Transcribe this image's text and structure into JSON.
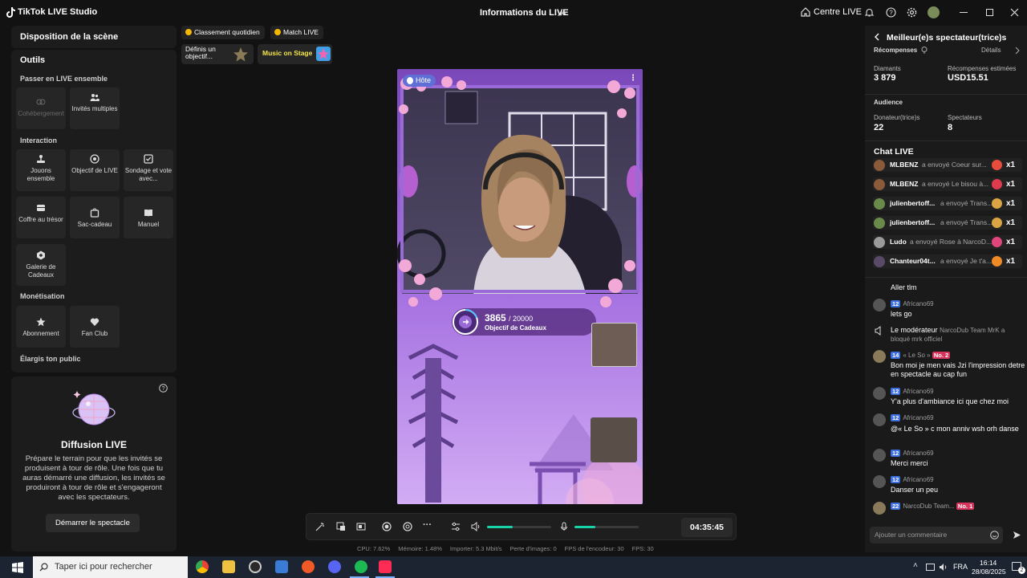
{
  "titlebar": {
    "app_name": "TikTok LIVE Studio",
    "center_title": "Informations du LIVE",
    "home_label": "Centre LIVE"
  },
  "left": {
    "scene_title": "Disposition de la scène",
    "tools_title": "Outils",
    "sections": {
      "together": "Passer en LIVE ensemble",
      "interaction": "Interaction",
      "monetisation": "Monétisation",
      "audience": "Élargis ton public"
    },
    "tools": {
      "cohost": "Cohébergement",
      "multi_guests": "Invités multiples",
      "play_together": "Jouons ensemble",
      "live_goal": "Objectif de LIVE",
      "poll": "Sondage et vote avec...",
      "treasure": "Coffre au trésor",
      "gift_bag": "Sac-cadeau",
      "manual": "Manuel",
      "gift_gallery": "Galerie de Cadeaux",
      "subscription": "Abonnement",
      "fan_club": "Fan Club"
    },
    "diffusion": {
      "title": "Diffusion LIVE",
      "description": "Prépare le terrain pour que les invités se produisent à tour de rôle. Une fois que tu auras démarré une diffusion, les invités se produiront à tour de rôle et s'engageront avec les spectateurs.",
      "button": "Démarrer le spectacle"
    }
  },
  "top_chips": {
    "daily_ranking": "Classement quotidien",
    "match_live": "Match LIVE",
    "goal_card": "Définis un objectif...",
    "music_card": "Music on Stage"
  },
  "stream": {
    "host_label": "Hôte",
    "goal_current": "3865",
    "goal_total": "/ 20000",
    "goal_label": "Objectif de Cadeaux",
    "goal_progress": 0.193
  },
  "controls": {
    "volume_level": 0.4,
    "mic_level": 0.32,
    "timer": "04:35:45"
  },
  "stats": {
    "cpu": "CPU:  7.62%",
    "memory": "Mémoire:  1.48%",
    "import": "Importer:  5.3 Mbit/s",
    "frame_loss": "Perte d'images:  0",
    "encoder_fps": "FPS de l'encodeur:  30",
    "fps": "FPS:  30"
  },
  "right": {
    "header": "Meilleur(e)s spectateur(trice)s",
    "rewards_label": "Récompenses",
    "details": "Détails",
    "diamonds_label": "Diamants",
    "diamonds_value": "3 879",
    "est_rewards_label": "Récompenses estimées",
    "est_rewards_value": "USD15.51",
    "audience_label": "Audience",
    "donors_label": "Donateur(trice)s",
    "donors_value": "22",
    "viewers_label": "Spectateurs",
    "viewers_value": "8",
    "chat_title": "Chat LIVE",
    "gifts": [
      {
        "user": "MLBENZ",
        "msg": "a envoyé Coeur sur...",
        "count": "x1",
        "color": "#e74c3c"
      },
      {
        "user": "MLBENZ",
        "msg": "a envoyé Le bisou à...",
        "count": "x1",
        "color": "#e03a4e"
      },
      {
        "user": "julienbertoff...",
        "msg": "a envoyé Trans...",
        "count": "x1",
        "color": "#d9a441"
      },
      {
        "user": "julienbertoff...",
        "msg": "a envoyé Trans...",
        "count": "x1",
        "color": "#d9a441"
      },
      {
        "user": "Ludo",
        "msg": "a envoyé Rose à NarcoD...",
        "count": "x1",
        "color": "#e0457b"
      },
      {
        "user": "Chanteur04t...",
        "msg": "a envoyé Je t'a...",
        "count": "x1",
        "color": "#f08a24"
      }
    ],
    "chat": [
      {
        "text": "Aller tlm"
      },
      {
        "badge": "12",
        "name": "Africano69",
        "text": "lets go"
      },
      {
        "name": "Le modérateur",
        "text": "NarcoDub Team MrK a bloqué mrk officiel"
      },
      {
        "badge": "14",
        "name": "« Le So »",
        "rank": "No. 2",
        "text": "Bon moi je men vais Jzi l'impression detre en spectacle au cap fun"
      },
      {
        "badge": "12",
        "name": "Africano69",
        "text": "Y'a plus d'ambiance ici que chez moi"
      },
      {
        "badge": "12",
        "name": "Africano69",
        "text": "@« Le So » c mon anniv wsh orh danse"
      },
      {
        "badge": "12",
        "name": "Africano69",
        "text": "Merci merci"
      },
      {
        "badge": "12",
        "name": "Africano69",
        "text": "Danser un peu"
      },
      {
        "badge": "22",
        "name": "NarcoDub Team...",
        "rank": "No. 1"
      }
    ],
    "comment_placeholder": "Ajouter un commentaire"
  },
  "taskbar": {
    "search_placeholder": "Taper ici pour rechercher",
    "lang": "FRA",
    "time": "16:14",
    "date": "28/08/2025",
    "notif_count": "2"
  }
}
